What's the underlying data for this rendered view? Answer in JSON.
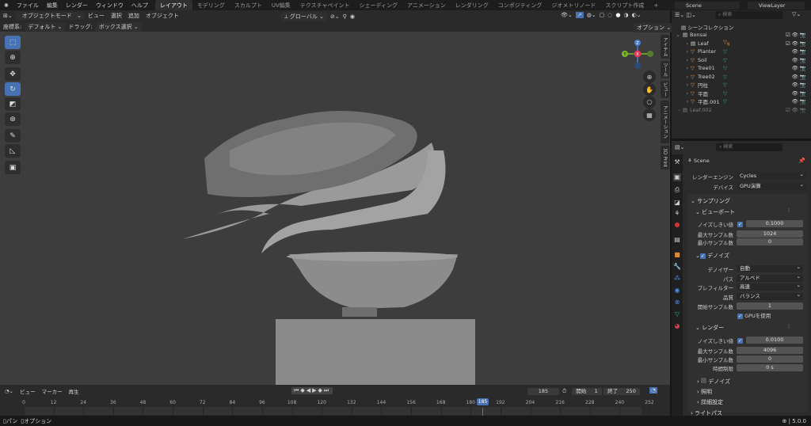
{
  "topbar": {
    "menus": [
      "ファイル",
      "編集",
      "レンダー",
      "ウィンドウ",
      "ヘルプ"
    ],
    "workspaces": [
      "レイアウト",
      "モデリング",
      "スカルプト",
      "UV編集",
      "テクスチャペイント",
      "シェーディング",
      "アニメーション",
      "レンダリング",
      "コンポジティング",
      "ジオメトリノード",
      "スクリプト作成"
    ],
    "add": "+",
    "scene": "Scene",
    "view_layer": "ViewLayer"
  },
  "viewport": {
    "mode": "オブジェクトモード",
    "menus": [
      "ビュー",
      "選択",
      "追加",
      "オブジェクト"
    ],
    "orientation": "グローバル",
    "coord_label": "座標系:",
    "coord_value": "デフォルト",
    "drag_label": "ドラッグ:",
    "drag_value": "ボックス選択",
    "options": "オプション",
    "gizmo": {
      "z": "Z",
      "y": "Y",
      "x": "X"
    },
    "side_tabs": [
      "アイテム",
      "ツール",
      "ビュー",
      "アニメーション",
      "3D Print"
    ]
  },
  "outliner": {
    "search_placeholder": "検索",
    "root": "シーンコレクション",
    "items": [
      {
        "name": "Bonsai",
        "level": 0,
        "type": "collection"
      },
      {
        "name": "Leaf",
        "level": 1,
        "type": "collection",
        "badge": "6"
      },
      {
        "name": "Planter",
        "level": 1,
        "type": "mesh"
      },
      {
        "name": "Soil",
        "level": 1,
        "type": "mesh"
      },
      {
        "name": "Tree01",
        "level": 1,
        "type": "mesh"
      },
      {
        "name": "Tree02",
        "level": 1,
        "type": "mesh"
      },
      {
        "name": "円柱",
        "level": 1,
        "type": "mesh"
      },
      {
        "name": "平面",
        "level": 1,
        "type": "mesh"
      },
      {
        "name": "平面.001",
        "level": 1,
        "type": "mesh"
      },
      {
        "name": "Leaf.002",
        "level": 0,
        "type": "collection",
        "dim": true
      }
    ]
  },
  "properties": {
    "search_placeholder": "検索",
    "scene": "Scene",
    "render_engine_label": "レンダーエンジン",
    "render_engine": "Cycles",
    "device_label": "デバイス",
    "device": "GPU演算",
    "sampling": "サンプリング",
    "viewport": "ビューポート",
    "vp_noise_label": "ノイズしきい値",
    "vp_noise": "0.1000",
    "vp_max_label": "最大サンプル数",
    "vp_max": "1024",
    "vp_min_label": "最小サンプル数",
    "vp_min": "0",
    "denoise": "デノイズ",
    "denoiser_label": "デノイザー",
    "denoiser": "自動",
    "passes_label": "パス",
    "passes": "アルベド",
    "prefilter_label": "プレフィルター",
    "prefilter": "高速",
    "quality_label": "品質",
    "quality": "バランス",
    "start_label": "開始サンプル数",
    "start": "1",
    "use_gpu": "GPUを使用",
    "render": "レンダー",
    "r_noise_label": "ノイズしきい値",
    "r_noise": "0.0100",
    "r_max_label": "最大サンプル数",
    "r_max": "4096",
    "r_min_label": "最小サンプル数",
    "r_min": "0",
    "time_label": "時間制限",
    "time": "0 s",
    "r_denoise": "デノイズ",
    "lighting": "照明",
    "advanced": "詳細設定",
    "light_paths": "ライトパス"
  },
  "timeline": {
    "menus": [
      "ビュー",
      "マーカー",
      "再生"
    ],
    "current": "185",
    "start_label": "開始",
    "start": "1",
    "end_label": "終了",
    "end": "250",
    "ticks": [
      0,
      12,
      24,
      36,
      48,
      60,
      72,
      84,
      96,
      108,
      120,
      132,
      144,
      156,
      168,
      180,
      192,
      204,
      216,
      228,
      240,
      252
    ]
  },
  "status": {
    "pan": "パン",
    "options": "オプション",
    "version": "5.0.0"
  },
  "colors": {
    "accent": "#4772b3",
    "mesh": "#e09a4a",
    "data": "#27b491"
  }
}
